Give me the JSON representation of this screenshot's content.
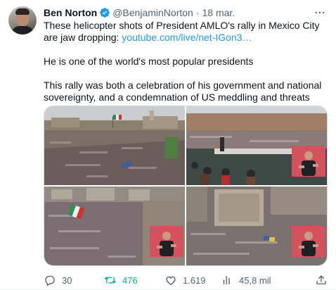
{
  "tweet": {
    "author_name": "Ben Norton",
    "handle": "@BenjaminNorton",
    "separator": "·",
    "date": "18 mar.",
    "text_line1_prefix": "These helicopter shots of President AMLO's rally in Mexico City are jaw dropping: ",
    "link": "youtube.com/live/net-IGon3…",
    "paragraph2": "He is one of the world's most popular presidents",
    "paragraph3": "This rally was both a celebration of his government and national sovereignty, and a condemnation of US meddling and threats"
  },
  "stats": {
    "replies": "30",
    "retweets": "476",
    "likes": "1.619",
    "views": "45,8 mil"
  },
  "colors": {
    "accent": "#1d9bf0",
    "retweet_active": "#00ba7c",
    "muted": "#536471"
  },
  "icons": [
    "verified-badge-icon",
    "more-icon",
    "reply-icon",
    "retweet-icon",
    "like-icon",
    "views-icon",
    "share-icon"
  ]
}
